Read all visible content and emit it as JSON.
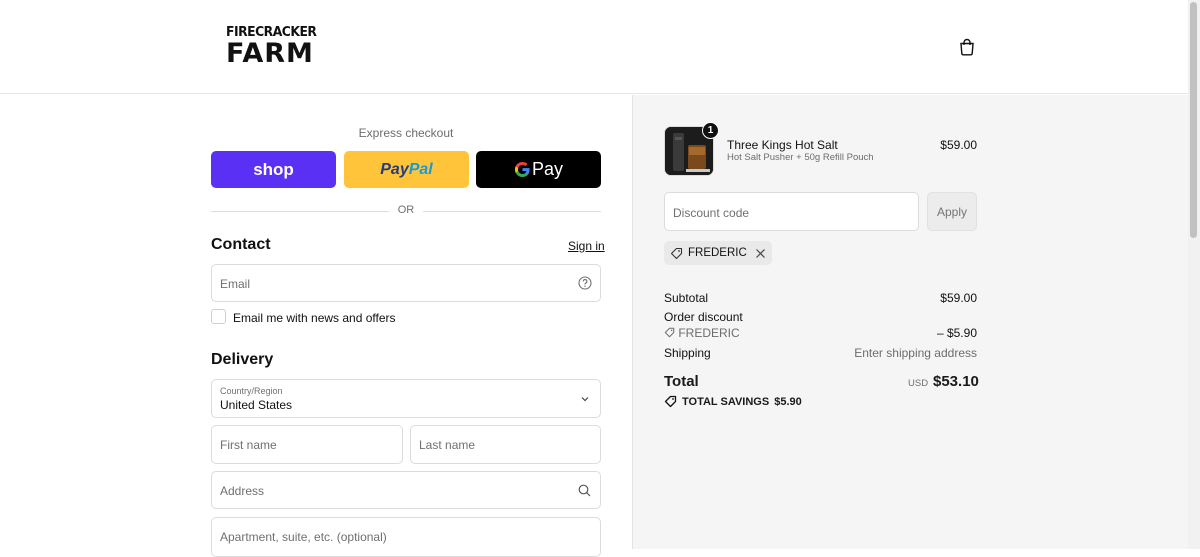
{
  "header": {
    "logo_line1": "FIRECRACKER",
    "logo_line2": "FARM"
  },
  "express": {
    "title": "Express checkout",
    "shop_label": "shop",
    "paypal_pay": "Pay",
    "paypal_pal": "Pal",
    "gpay_label": "Pay",
    "or": "OR"
  },
  "contact": {
    "title": "Contact",
    "signin": "Sign in",
    "email_placeholder": "Email",
    "news_label": "Email me with news and offers"
  },
  "delivery": {
    "title": "Delivery",
    "country_label": "Country/Region",
    "country_value": "United States",
    "first_name": "First name",
    "last_name": "Last name",
    "address": "Address",
    "apartment": "Apartment, suite, etc. (optional)"
  },
  "cart": {
    "item": {
      "quantity": "1",
      "name": "Three Kings Hot Salt",
      "variant": "Hot Salt Pusher + 50g Refill Pouch",
      "price": "$59.00"
    },
    "discount_placeholder": "Discount code",
    "apply_label": "Apply",
    "applied_code": "FREDERIC"
  },
  "summary": {
    "subtotal_label": "Subtotal",
    "subtotal_value": "$59.00",
    "order_discount_label": "Order discount",
    "discount_code": "FREDERIC",
    "discount_value": "– $5.90",
    "shipping_label": "Shipping",
    "shipping_value": "Enter shipping address",
    "total_label": "Total",
    "currency": "USD",
    "total_value": "$53.10",
    "savings_label": "TOTAL SAVINGS",
    "savings_value": "$5.90"
  },
  "colors": {
    "shop": "#5a31f4",
    "paypal": "#ffc439",
    "gpay": "#000000",
    "sidebar_bg": "#f5f5f5"
  }
}
